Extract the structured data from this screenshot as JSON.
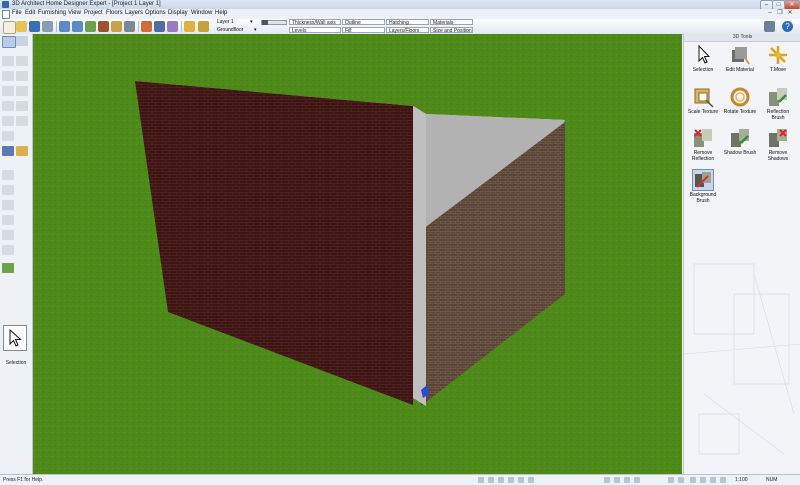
{
  "window": {
    "title": "3D Architect Home Designer Expert - [Project 1 Layer 1]",
    "minimize": "–",
    "maximize": "□",
    "close": "✕"
  },
  "menu": [
    "File",
    "Edit",
    "Furnishing",
    "View",
    "Project",
    "Floors",
    "Layers",
    "Options",
    "Display",
    "Window",
    "Help"
  ],
  "mdi_controls": {
    "minimize": "–",
    "restore": "❐",
    "close": "✕"
  },
  "toolbar": {
    "layer_combo": "Layer 1",
    "floor_combo": "Groundfloor",
    "fields_top": [
      "Thickness/Wall axis",
      "Outline",
      "Hatching",
      "Materials"
    ],
    "fields_bottom": [
      "Levels",
      "Fill",
      "Layers/Floors",
      "Size and Position"
    ]
  },
  "left": {
    "selection_caption": "Selection"
  },
  "panel": {
    "title": "3D Tools",
    "tools": [
      {
        "label": "Selection"
      },
      {
        "label": "Edit Material"
      },
      {
        "label": "T.Move"
      },
      {
        "label": "Scale Texture"
      },
      {
        "label": "Rotate Texture"
      },
      {
        "label": "Reflection Brush"
      },
      {
        "label": "Remove Reflection"
      },
      {
        "label": "Shadow Brush"
      },
      {
        "label": "Remove Shadows"
      },
      {
        "label": "Background Brush"
      }
    ]
  },
  "status": {
    "help": "Press F1 for Help.",
    "scale": "1:100",
    "num": "NUM"
  },
  "colors": {
    "grass": "#4d8a1a",
    "front_wall": "#3e1515",
    "side_wall": "#5a4436",
    "top_face": "#f2f2f2",
    "panel_bg": "#f2f4f8",
    "accent": "#2e6db4"
  }
}
